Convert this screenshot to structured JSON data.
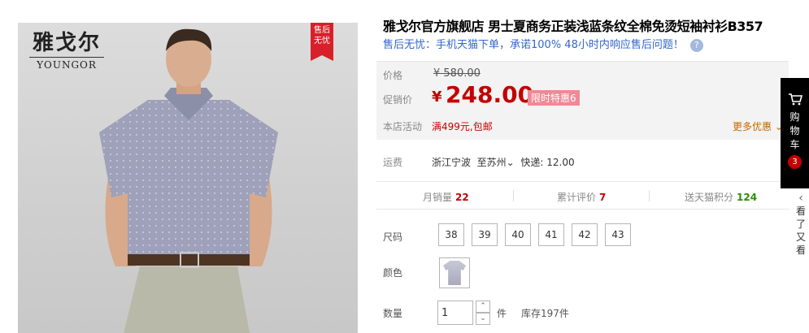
{
  "brand": {
    "cn": "雅戈尔",
    "en": "YOUNGOR"
  },
  "badge": {
    "line1": "售后",
    "line2": "无忧"
  },
  "product": {
    "title": "雅戈尔官方旗舰店 男士夏商务正装浅蓝条纹全棉免烫短袖衬衫B357",
    "subtitle": "售后无忧：手机天猫下单，承诺100% 48小时内响应售后问题！",
    "help_icon": "?"
  },
  "price": {
    "orig_label": "价格",
    "orig_value": "¥ 580.00",
    "cur_label": "促销价",
    "currency": "¥",
    "cur_value": "248.00",
    "promo_tag": "限时特惠6",
    "store_label": "本店活动",
    "store_promo": "满499元,包邮",
    "more": "更多优惠"
  },
  "shipping": {
    "label": "运费",
    "from": "浙江宁波",
    "to": "至苏州",
    "method": "快递: 12.00"
  },
  "stats": {
    "monthly_label": "月销量",
    "monthly": "22",
    "reviews_label": "累计评价",
    "reviews": "7",
    "points_label": "送天猫积分",
    "points": "124"
  },
  "sizes": {
    "label": "尺码",
    "options": [
      "38",
      "39",
      "40",
      "41",
      "42",
      "43"
    ]
  },
  "color": {
    "label": "颜色"
  },
  "quantity": {
    "label": "数量",
    "value": "1",
    "unit": "件",
    "stock": "库存197件"
  },
  "cart": {
    "chars": [
      "购",
      "物",
      "车"
    ],
    "count": "3"
  },
  "see_also": {
    "chars": [
      "看",
      "了",
      "又",
      "看"
    ]
  },
  "colors": {
    "accent": "#c40000",
    "link": "#3366cc",
    "promo_tag": "#f18896",
    "badge": "#d8202a",
    "points": "#2a8f00"
  }
}
